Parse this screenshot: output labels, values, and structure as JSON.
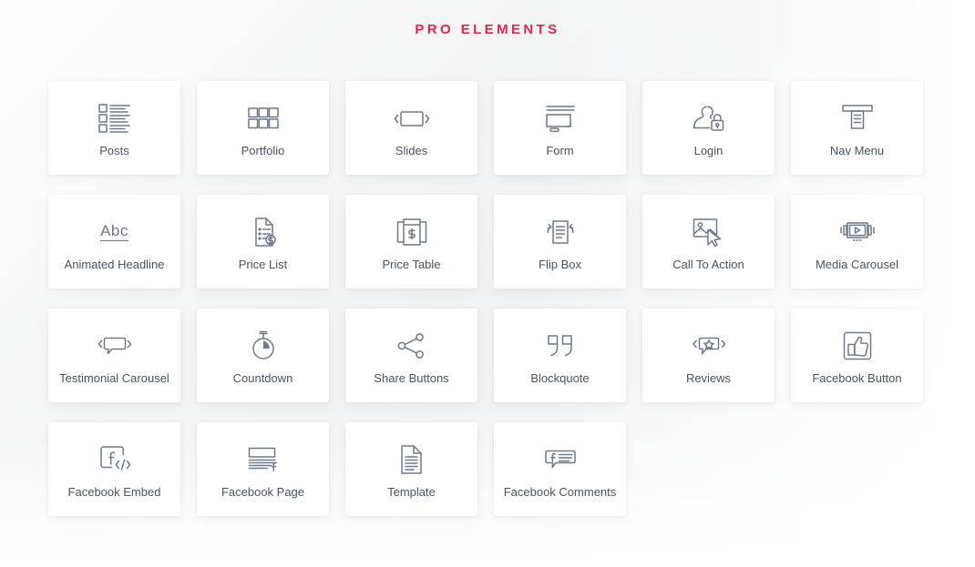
{
  "section": {
    "title": "PRO ELEMENTS",
    "title_color": "#e2254f",
    "background_color": "#ffffff",
    "card_background": "#ffffff",
    "icon_color": "#6d7a8c",
    "label_color": "#4a5464"
  },
  "grid": {
    "columns": 6,
    "rows": 4,
    "total_items": 22,
    "items": [
      {
        "label": "Posts",
        "icon": "posts-list-icon"
      },
      {
        "label": "Portfolio",
        "icon": "grid-squares-icon"
      },
      {
        "label": "Slides",
        "icon": "slides-arrows-icon"
      },
      {
        "label": "Form",
        "icon": "form-fields-icon"
      },
      {
        "label": "Login",
        "icon": "user-lock-icon"
      },
      {
        "label": "Nav Menu",
        "icon": "nav-menu-dropdown-icon"
      },
      {
        "label": "Animated Headline",
        "icon": "abc-underline-icon"
      },
      {
        "label": "Price List",
        "icon": "document-price-list-icon"
      },
      {
        "label": "Price Table",
        "icon": "price-table-dollar-icon"
      },
      {
        "label": "Flip Box",
        "icon": "flip-box-rotate-icon"
      },
      {
        "label": "Call To Action",
        "icon": "image-cursor-icon"
      },
      {
        "label": "Media Carousel",
        "icon": "media-play-frame-icon"
      },
      {
        "label": "Testimonial Carousel",
        "icon": "speech-bubble-arrows-icon"
      },
      {
        "label": "Countdown",
        "icon": "stopwatch-icon"
      },
      {
        "label": "Share Buttons",
        "icon": "share-network-icon"
      },
      {
        "label": "Blockquote",
        "icon": "quotation-marks-icon"
      },
      {
        "label": "Reviews",
        "icon": "star-bubble-arrows-icon"
      },
      {
        "label": "Facebook Button",
        "icon": "thumbs-up-box-icon"
      },
      {
        "label": "Facebook Embed",
        "icon": "facebook-code-box-icon"
      },
      {
        "label": "Facebook Page",
        "icon": "facebook-page-lines-icon"
      },
      {
        "label": "Template",
        "icon": "document-lines-icon"
      },
      {
        "label": "Facebook Comments",
        "icon": "facebook-comment-bubble-icon"
      }
    ]
  },
  "glyphs": {
    "abc": "Abc",
    "dollar": "$",
    "facebook_f": "f",
    "code": "</>"
  }
}
